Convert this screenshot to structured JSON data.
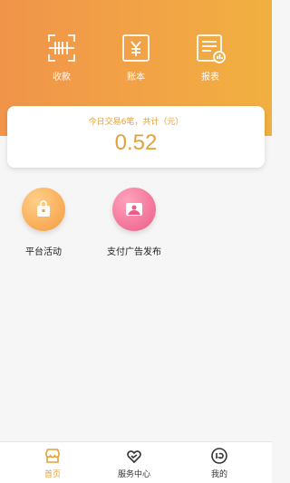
{
  "quick_actions": [
    {
      "label": "收款",
      "icon": "scan-icon"
    },
    {
      "label": "账本",
      "icon": "ledger-icon"
    },
    {
      "label": "报表",
      "icon": "report-icon"
    }
  ],
  "summary": {
    "subtitle": "今日交易6笔，共计（元）",
    "amount": "0.52"
  },
  "features": [
    {
      "label": "平台活动",
      "icon": "shopping-bag-icon",
      "color": "#f6a04a"
    },
    {
      "label": "支付广告发布",
      "icon": "image-icon",
      "color": "#ee6b93"
    }
  ],
  "tabs": [
    {
      "label": "首页",
      "icon": "store-icon",
      "active": true
    },
    {
      "label": "服务中心",
      "icon": "heart-hands-icon",
      "active": false
    },
    {
      "label": "我的",
      "icon": "profile-icon",
      "active": false
    }
  ],
  "colors": {
    "accent": "#e3a13a",
    "header_start": "#f0944a",
    "header_end": "#f0b040"
  }
}
